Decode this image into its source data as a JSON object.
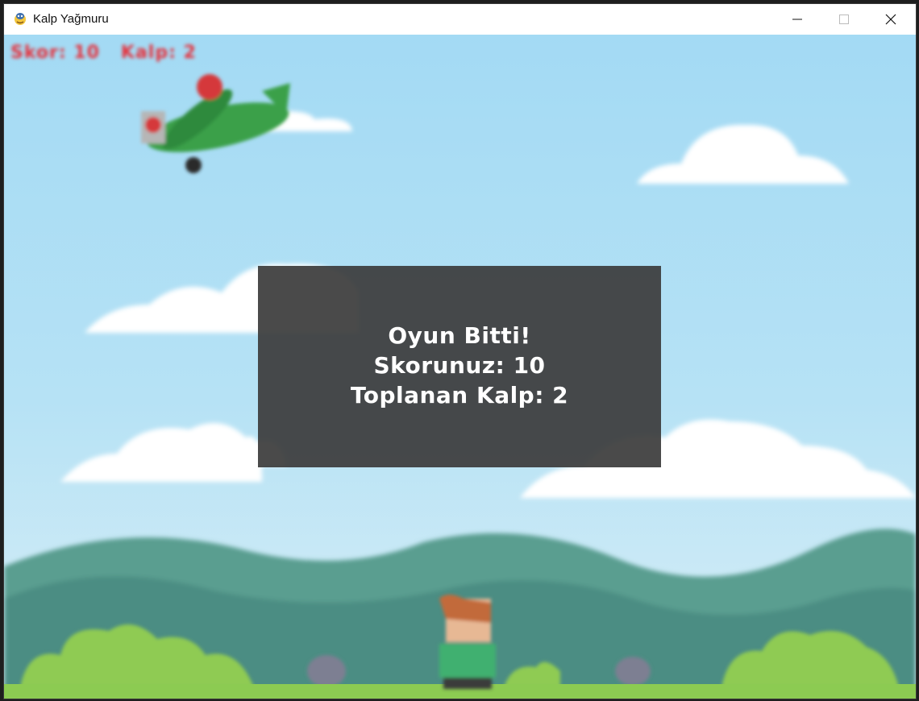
{
  "window": {
    "title": "Kalp Yağmuru",
    "controls": {
      "minimize": "minimize-icon",
      "maximize": "maximize-icon",
      "close": "close-icon"
    }
  },
  "hud": {
    "text": "Skor: 10   Kalp: 2"
  },
  "game_over": {
    "title": "Oyun Bitti!",
    "score_line": "Skorunuz: 10",
    "hearts_line": "Toplanan Kalp: 2"
  },
  "colors": {
    "sky": "#a8dcf3",
    "hud": "#e5313c",
    "overlay": "#3c3c3c",
    "hills": "#4f9186",
    "grass": "#8ccb52"
  }
}
